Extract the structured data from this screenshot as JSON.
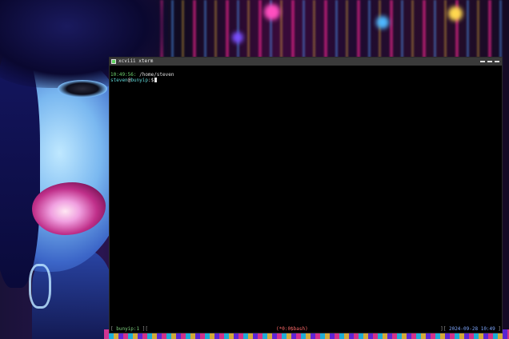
{
  "window": {
    "title": "xcviii xterm"
  },
  "terminal": {
    "line1_time": "10:49:56:",
    "line1_path": " /home/steven",
    "prompt_user": "steven",
    "prompt_at": "@",
    "prompt_host": "bunyip",
    "prompt_suffix": ":$"
  },
  "status_bar": {
    "left_open": "[ ",
    "session": "bunyip:1",
    "left_close": " ][",
    "window_label": "(*0:0$bash)",
    "right_open": "][ ",
    "datetime": "2024-09-28 10:49",
    "right_close": " ]"
  }
}
